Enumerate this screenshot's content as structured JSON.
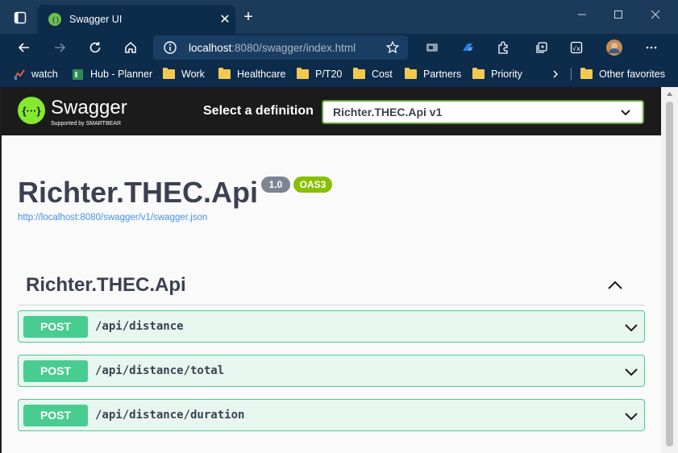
{
  "browser": {
    "tab_title": "Swagger UI",
    "url_host": "localhost",
    "url_rest": ":8080/swagger/index.html"
  },
  "favorites": [
    {
      "label": "watch",
      "icon": "chart-icon"
    },
    {
      "label": "Hub - Planner",
      "icon": "planner-icon"
    },
    {
      "label": "Work",
      "icon": "folder-icon"
    },
    {
      "label": "Healthcare",
      "icon": "folder-icon"
    },
    {
      "label": "P/T20",
      "icon": "folder-icon"
    },
    {
      "label": "Cost",
      "icon": "folder-icon"
    },
    {
      "label": "Partners",
      "icon": "folder-icon"
    },
    {
      "label": "Priority",
      "icon": "folder-icon"
    },
    {
      "label": "Other favorites",
      "icon": "folder-icon"
    }
  ],
  "swagger": {
    "logo_text": "Swagger",
    "logo_sub": "Supported by SMARTBEAR",
    "definition_label": "Select a definition",
    "definition_value": "Richter.THEC.Api v1",
    "api_title": "Richter.THEC.Api",
    "version_badge": "1.0",
    "oas_badge": "OAS3",
    "spec_url": "http://localhost:8080/swagger/v1/swagger.json",
    "tag_name": "Richter.THEC.Api",
    "operations": [
      {
        "method": "POST",
        "path": "/api/distance"
      },
      {
        "method": "POST",
        "path": "/api/distance/total"
      },
      {
        "method": "POST",
        "path": "/api/distance/duration"
      }
    ]
  },
  "colors": {
    "post_green": "#49cc90",
    "swagger_green": "#85ea2d",
    "browser_chrome": "#0d2b4a"
  }
}
